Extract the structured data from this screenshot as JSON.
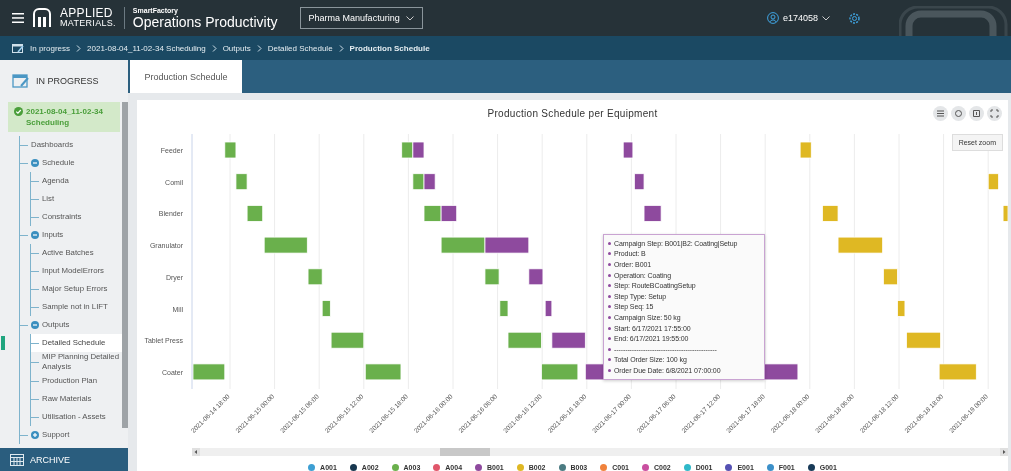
{
  "header": {
    "brand_top": "APPLIED",
    "brand_bottom": "MATERIALS.",
    "product_small": "SmartFactory",
    "product": "Operations Productivity",
    "site_selector": "Pharma Manufacturing",
    "user": "e174058"
  },
  "breadcrumb": [
    {
      "label": "In progress",
      "selected": false
    },
    {
      "label": "2021-08-04_11-02-34 Scheduling",
      "selected": false
    },
    {
      "label": "Outputs",
      "selected": false
    },
    {
      "label": "Detailed Schedule",
      "selected": false
    },
    {
      "label": "Production Schedule",
      "selected": true
    }
  ],
  "sidebar": {
    "section_title": "IN PROGRESS",
    "run": {
      "label": "2021-08-04_11-02-34 Scheduling",
      "selected": true
    },
    "tree": [
      {
        "label": "Dashboards",
        "selected": false
      },
      {
        "label": "Schedule",
        "selected": false,
        "expanded": true,
        "children": [
          {
            "label": "Agenda",
            "selected": false
          },
          {
            "label": "List",
            "selected": false
          },
          {
            "label": "Constraints",
            "selected": false
          }
        ]
      },
      {
        "label": "Inputs",
        "selected": false,
        "expanded": true,
        "children": [
          {
            "label": "Active Batches",
            "selected": false
          },
          {
            "label": "Input ModelErrors",
            "selected": false
          },
          {
            "label": "Major Setup Errors",
            "selected": false
          },
          {
            "label": "Sample not in LIFT",
            "selected": false
          }
        ]
      },
      {
        "label": "Outputs",
        "selected": false,
        "expanded": true,
        "children": [
          {
            "label": "Detailed Schedule",
            "selected": true
          },
          {
            "label": "MIP Planning Detailed Analysis",
            "selected": false
          },
          {
            "label": "Production Plan",
            "selected": false
          },
          {
            "label": "Raw Materials",
            "selected": false
          },
          {
            "label": "Utilisation - Assets",
            "selected": false
          }
        ]
      },
      {
        "label": "Support",
        "selected": false,
        "expanded": false
      }
    ],
    "footer": "ARCHIVE"
  },
  "tabs": [
    {
      "label": "Production Schedule",
      "selected": true
    }
  ],
  "schedule": {
    "title": "Production Schedule per Equipment",
    "reset_zoom": "Reset zoom",
    "ticks": [
      "2021-06-14 18:00",
      "2021-06-15 00:00",
      "2021-06-15 06:00",
      "2021-06-15 12:00",
      "2021-06-15 18:00",
      "2021-06-16 00:00",
      "2021-06-16 06:00",
      "2021-06-16 12:00",
      "2021-06-16 18:00",
      "2021-06-17 00:00",
      "2021-06-17 06:00",
      "2021-06-17 12:00",
      "2021-06-17 18:00",
      "2021-06-18 00:00",
      "2021-06-18 06:00",
      "2021-06-18 12:00",
      "2021-06-18 18:00",
      "2021-06-19 00:00"
    ],
    "rows": [
      "Feeder",
      "Comil",
      "Blender",
      "Granulator",
      "Dryer",
      "Mill",
      "Tablet Press",
      "Coater"
    ],
    "legend": [
      {
        "label": "A001",
        "color": "#3d9fd3"
      },
      {
        "label": "A002",
        "color": "#17374f"
      },
      {
        "label": "A003",
        "color": "#6ab04c"
      },
      {
        "label": "A004",
        "color": "#e0566a"
      },
      {
        "label": "B001",
        "color": "#8e4a9e"
      },
      {
        "label": "B002",
        "color": "#dfb823"
      },
      {
        "label": "B003",
        "color": "#4b7b82"
      },
      {
        "label": "C001",
        "color": "#f0823c"
      },
      {
        "label": "C002",
        "color": "#c94fa0"
      },
      {
        "label": "D001",
        "color": "#2fb9c9"
      },
      {
        "label": "E001",
        "color": "#5551b3"
      },
      {
        "label": "F001",
        "color": "#3c90c9"
      },
      {
        "label": "G001",
        "color": "#183a58"
      }
    ],
    "tooltip": {
      "lines": [
        "Campaign Step: B001|B2: Coating|Setup",
        "Product: B",
        "Order: B001",
        "Operation: Coating",
        "Step: RouteBCoatingSetup",
        "Step Type: Setup",
        "Step Seq: 15",
        "Campaign Size: 50 kg",
        "Start: 6/17/2021 17:55:00",
        "End: 6/17/2021 19:55:00",
        "----------------------------------------------",
        "Total Order Size: 100 kg",
        "Order Due Date: 6/8/2021 07:00:00"
      ]
    }
  }
}
